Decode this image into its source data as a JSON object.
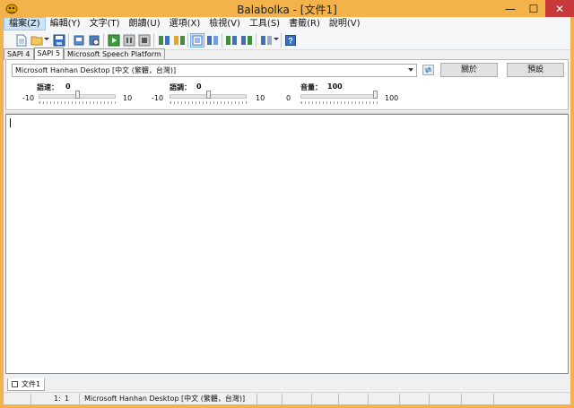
{
  "window": {
    "title": "Balabolka - [文件1]",
    "min_glyph": "—",
    "max_glyph": "☐",
    "close_glyph": "✕"
  },
  "menu": [
    "檔案(Z)",
    "編輯(Y)",
    "文字(T)",
    "朗讀(U)",
    "選項(X)",
    "檢視(V)",
    "工具(S)",
    "書籤(R)",
    "說明(V)"
  ],
  "toolbar": {
    "icons": [
      "new-file-icon",
      "open-folder-icon",
      "save-icon",
      "print-icon",
      "print-preview-icon",
      "play-icon",
      "pause-icon",
      "stop-icon",
      "save-audio-icon",
      "convert-icon",
      "text-view-icon",
      "clipboard-read-icon",
      "bookmark-icon",
      "bookmark-go-icon",
      "voice-options-icon",
      "help-icon"
    ]
  },
  "tabs": [
    "SAPI 4",
    "SAPI 5",
    "Microsoft Speech Platform"
  ],
  "active_tab": "SAPI 5",
  "voice": {
    "selected": "Microsoft Hanhan Desktop [中文 (繁體，台灣)]",
    "about_label": "關於",
    "preset_label": "預設"
  },
  "sliders": [
    {
      "label": "語速：",
      "value": "0",
      "min": "-10",
      "max": "10",
      "position": 0.5
    },
    {
      "label": "語調：",
      "value": "0",
      "min": "-10",
      "max": "10",
      "position": 0.5
    },
    {
      "label": "音量：",
      "value": "100",
      "min": "0",
      "max": "100",
      "position": 1.0
    }
  ],
  "editor": {
    "content": ""
  },
  "documents": [
    "文件1"
  ],
  "status": {
    "line": "1:",
    "col": "1",
    "voice": "Microsoft Hanhan Desktop [中文 (繁體，台灣)]"
  },
  "colors": {
    "titlebar": "#f3b24a",
    "close": "#c7383a",
    "selection": "#cce4f7"
  }
}
